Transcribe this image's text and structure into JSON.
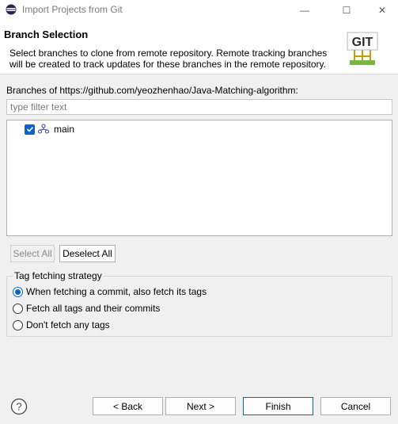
{
  "window": {
    "title": "Import Projects from Git",
    "minimize_glyph": "—",
    "maximize_glyph": "☐",
    "close_glyph": "✕"
  },
  "header": {
    "title": "Branch Selection",
    "description": "Select branches to clone from remote repository. Remote tracking branches will be created to track updates for these branches in the remote repository.",
    "logo_text": "GIT"
  },
  "branches": {
    "label": "Branches of https://github.com/yeozhenhao/Java-Matching-algorithm:",
    "filter_placeholder": "type filter text",
    "filter_value": "",
    "items": [
      {
        "name": "main",
        "checked": true,
        "icon": "branch-icon"
      }
    ]
  },
  "selection_buttons": {
    "select_all": "Select All",
    "deselect_all": "Deselect All"
  },
  "tag_fetching": {
    "legend": "Tag fetching strategy",
    "options": [
      {
        "label": "When fetching a commit, also fetch its tags",
        "checked": true
      },
      {
        "label": "Fetch all tags and their commits",
        "checked": false
      },
      {
        "label": "Don't fetch any tags",
        "checked": false
      }
    ]
  },
  "footer": {
    "help_icon": "help-icon",
    "back": "< Back",
    "next": "Next >",
    "finish": "Finish",
    "cancel": "Cancel"
  },
  "colors": {
    "accent": "#0a64c8",
    "header_bg": "#ffffff",
    "dialog_bg": "#f0f0f0"
  }
}
